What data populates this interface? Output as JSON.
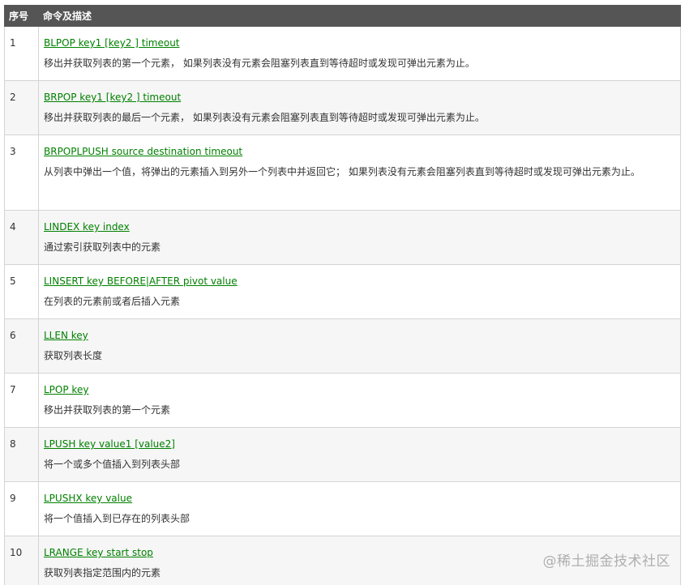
{
  "header": {
    "num_label": "序号",
    "cmd_label": "命令及描述"
  },
  "rows": [
    {
      "num": "1",
      "cmd": "BLPOP key1 [key2 ] timeout",
      "desc": "移出并获取列表的第一个元素， 如果列表没有元素会阻塞列表直到等待超时或发现可弹出元素为止。"
    },
    {
      "num": "2",
      "cmd": "BRPOP key1 [key2 ] timeout",
      "desc": "移出并获取列表的最后一个元素， 如果列表没有元素会阻塞列表直到等待超时或发现可弹出元素为止。"
    },
    {
      "num": "3",
      "cmd": "BRPOPLPUSH source destination timeout",
      "desc": "从列表中弹出一个值，将弹出的元素插入到另外一个列表中并返回它； 如果列表没有元素会阻塞列表直到等待超时或发现可弹出元素为止。"
    },
    {
      "num": "4",
      "cmd": "LINDEX key index",
      "desc": "通过索引获取列表中的元素"
    },
    {
      "num": "5",
      "cmd": "LINSERT key BEFORE|AFTER pivot value",
      "desc": "在列表的元素前或者后插入元素"
    },
    {
      "num": "6",
      "cmd": "LLEN key",
      "desc": "获取列表长度"
    },
    {
      "num": "7",
      "cmd": "LPOP key",
      "desc": "移出并获取列表的第一个元素"
    },
    {
      "num": "8",
      "cmd": "LPUSH key value1 [value2]",
      "desc": "将一个或多个值插入到列表头部"
    },
    {
      "num": "9",
      "cmd": "LPUSHX key value",
      "desc": "将一个值插入到已存在的列表头部"
    },
    {
      "num": "10",
      "cmd": "LRANGE key start stop",
      "desc": "获取列表指定范围内的元素"
    }
  ],
  "watermark": "@稀土掘金技术社区"
}
